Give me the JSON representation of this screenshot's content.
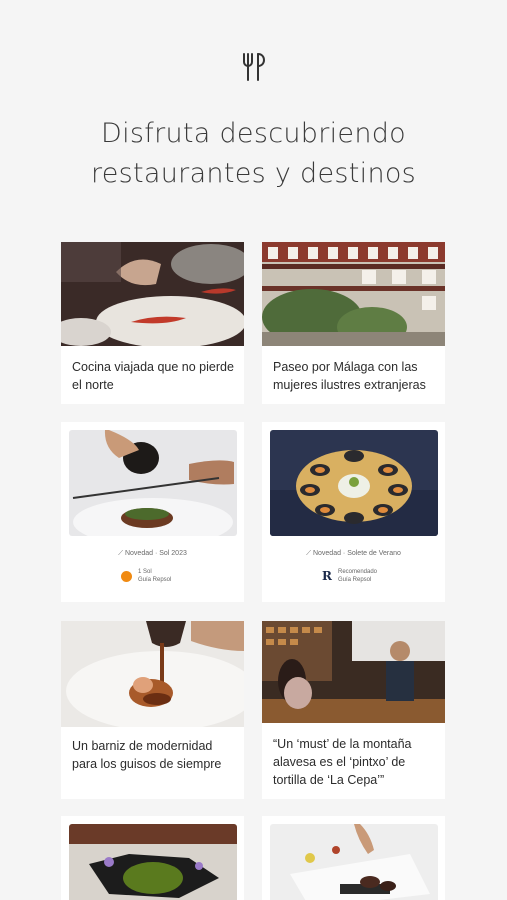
{
  "header": {
    "logo_icon": "fork-knife-icon",
    "headline_line1": "Disfruta descubriendo",
    "headline_line2": "restaurantes y destinos"
  },
  "cards": [
    {
      "title": "Cocina viajada que no pierde el norte",
      "image_icon": "chef-plating-photo"
    },
    {
      "title": "Paseo por Málaga con las mujeres ilustres extranjeras",
      "image_icon": "patio-courtyard-photo"
    },
    {
      "meta": "Novedad · Sol 2023",
      "badge_line1": "1 Sol",
      "badge_line2": "Guía Repsol",
      "image_icon": "truffle-shaving-photo",
      "badge_color": "#f08a12"
    },
    {
      "meta": "Novedad · Solete de Verano",
      "badge_line1": "Recomendado",
      "badge_line2": "Guía Repsol",
      "image_icon": "mussels-platter-photo",
      "badge_mark": "R"
    },
    {
      "title": "Un barniz de modernidad para los guisos de siempre",
      "image_icon": "sauce-pouring-photo"
    },
    {
      "title": "“Un ‘must’ de la montaña alavesa es el ‘pintxo’ de tortilla de ‘La Cepa’”",
      "image_icon": "bar-counter-photo"
    },
    {
      "image_icon": "green-soup-photo"
    },
    {
      "image_icon": "tasting-plate-photo"
    }
  ]
}
